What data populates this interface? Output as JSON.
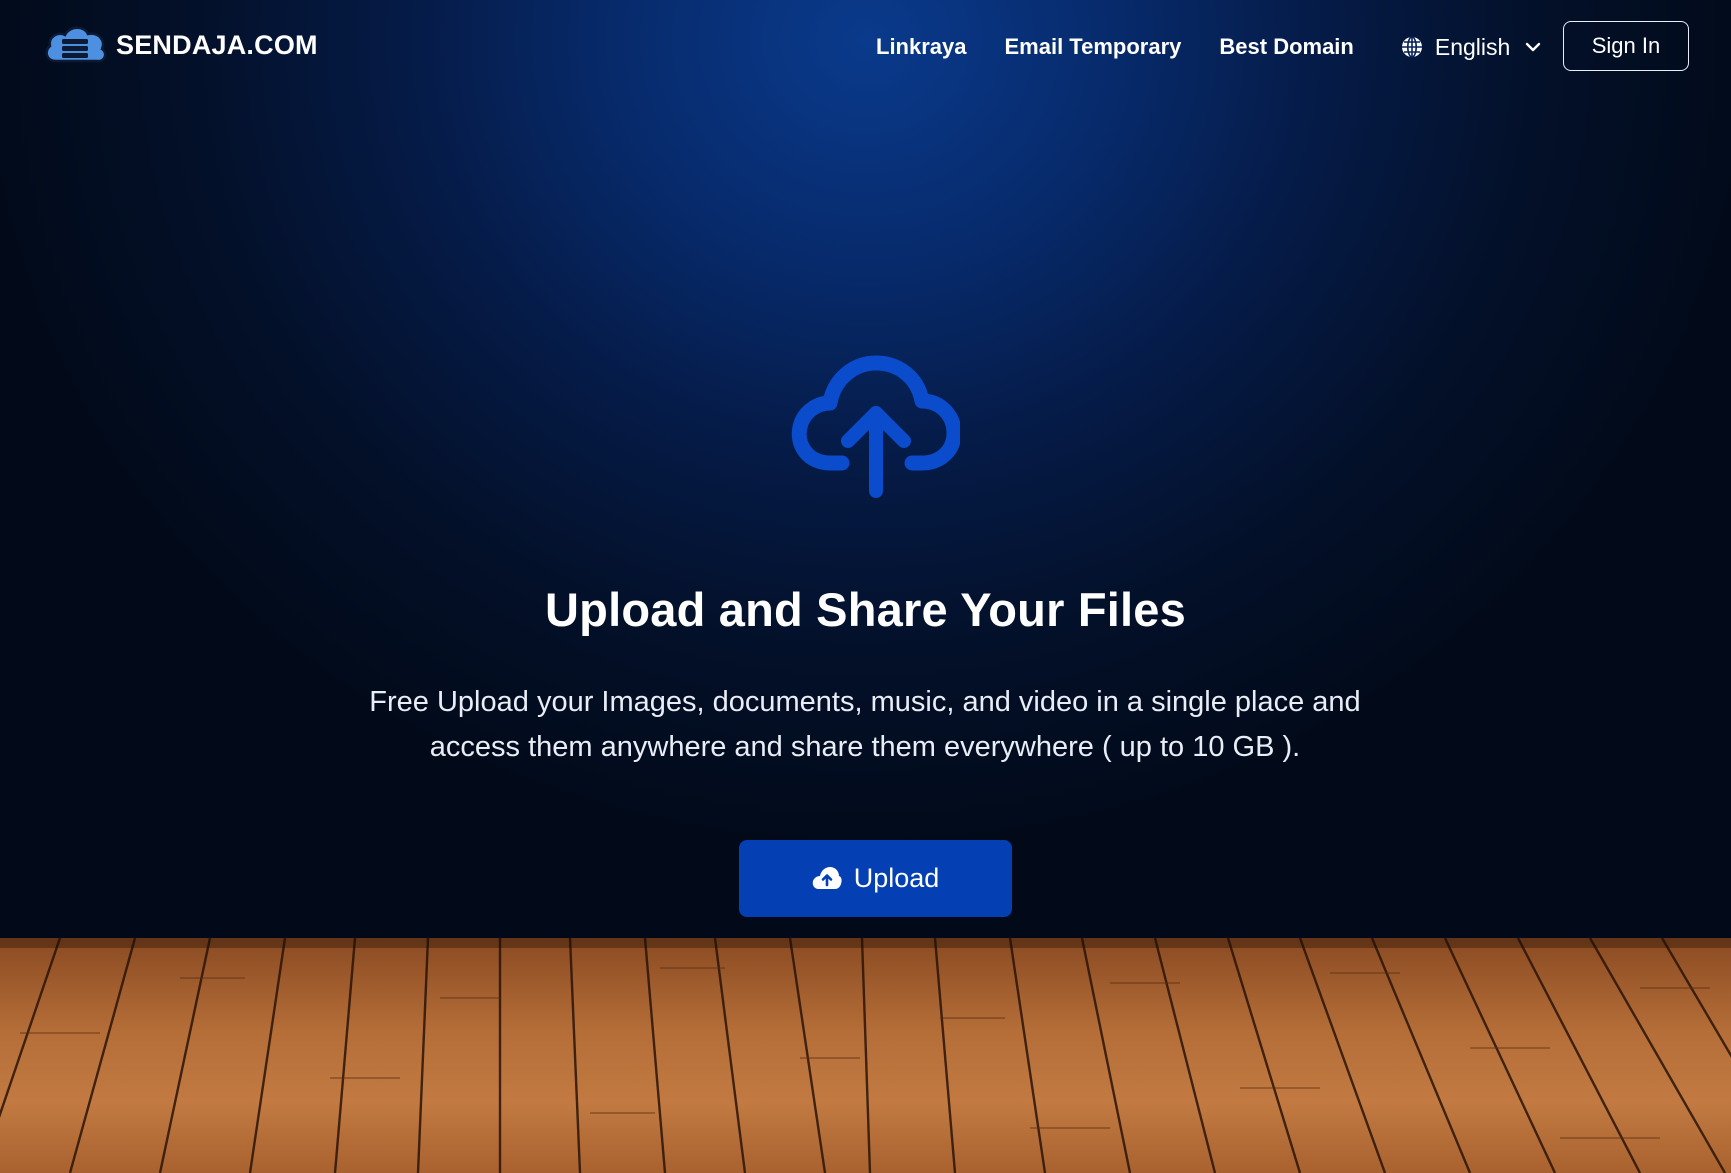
{
  "brand": {
    "name": "SENDAJA.COM",
    "logo_icon": "cloud-server-icon",
    "colors": {
      "accent": "#0440b3",
      "logo_blue": "#4d8fe0"
    }
  },
  "nav": {
    "items": [
      {
        "label": "Linkraya"
      },
      {
        "label": "Email Temporary"
      },
      {
        "label": "Best Domain"
      }
    ],
    "language": {
      "icon": "globe-icon",
      "label": "English",
      "chevron": "chevron-down-icon"
    },
    "sign_in_label": "Sign In"
  },
  "hero": {
    "icon": "cloud-upload-icon",
    "title": "Upload and Share Your Files",
    "description": "Free Upload your Images, documents, music, and video in a single place and access them anywhere and share them everywhere ( up to 10 GB ).",
    "upload_button": {
      "icon": "cloud-upload-icon",
      "label": "Upload"
    }
  }
}
